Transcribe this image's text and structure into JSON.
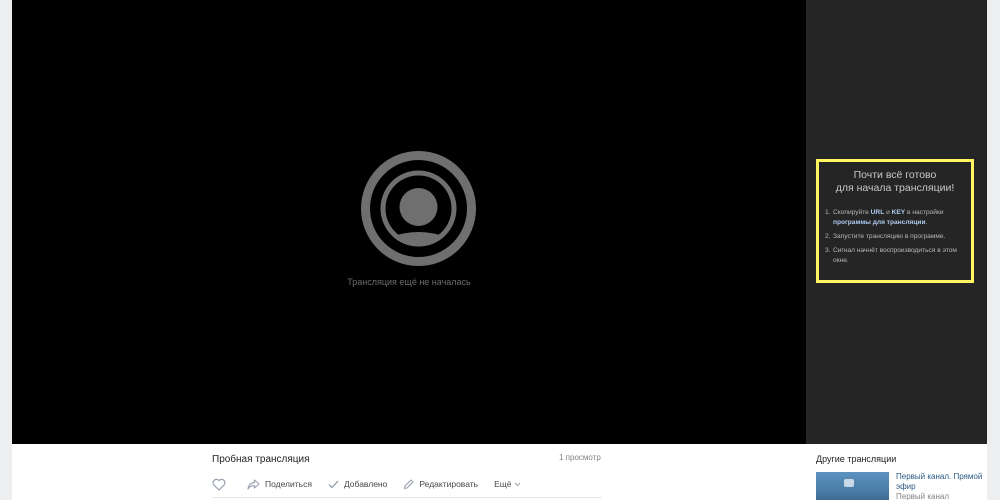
{
  "player": {
    "status_text": "Трансляция ещё не началась",
    "placeholder_icon": "live-broadcast-icon"
  },
  "instructions": {
    "title_line1": "Почти всё готово",
    "title_line2": "для начала трансляции!",
    "steps": [
      {
        "num": "1.",
        "pre": "Скопируйте ",
        "url": "URL",
        "and": " и ",
        "key": "KEY",
        "mid": " в настройки ",
        "link": "программы для трансляции",
        "end": "."
      },
      {
        "num": "2.",
        "text": "Запустите трансляцию в программе."
      },
      {
        "num": "3.",
        "text": "Сигнал начнёт воспроизводиться в этом окне."
      }
    ],
    "border_color": "#fef560"
  },
  "video": {
    "title": "Пробная трансляция",
    "views": "1 просмотр",
    "actions": {
      "share": "Поделиться",
      "added": "Добавлено",
      "edit": "Редактировать",
      "more": "Ещё"
    }
  },
  "other": {
    "heading": "Другие трансляции",
    "items": [
      {
        "name": "Первый канал. Прямой эфир",
        "channel": "Первый канал"
      }
    ]
  },
  "colors": {
    "page_bg": "#edeef0",
    "player_bg": "#000000",
    "panel_bg": "#252525",
    "link": "#2a5885",
    "accent": "#aecbf2"
  }
}
